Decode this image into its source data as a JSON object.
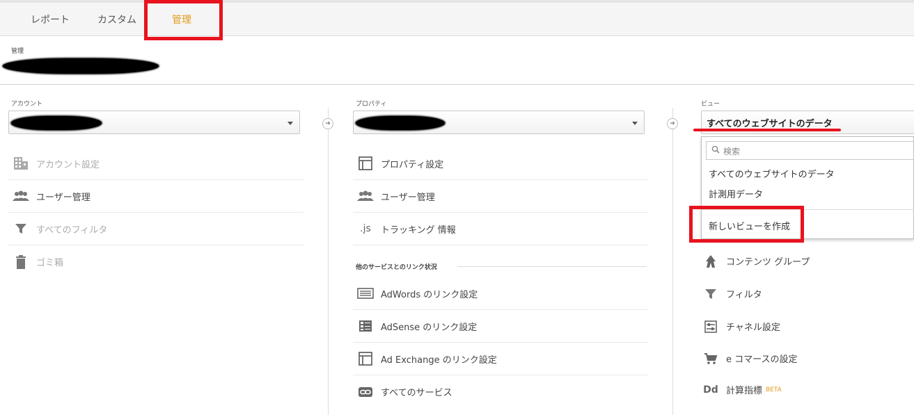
{
  "tabs": {
    "reports": "レポート",
    "custom": "カスタム",
    "admin": "管理"
  },
  "breadcrumb_label": "管理",
  "account": {
    "label": "アカウント",
    "items": [
      "アカウント設定",
      "ユーザー管理",
      "すべてのフィルタ",
      "ゴミ箱"
    ]
  },
  "property": {
    "label": "プロパティ",
    "items": [
      "プロパティ設定",
      "ユーザー管理",
      "トラッキング 情報"
    ],
    "section_title": "他のサービスとのリンク状況",
    "link_items": [
      "AdWords のリンク設定",
      "AdSense のリンク設定",
      "Ad Exchange のリンク設定",
      "すべてのサービス"
    ]
  },
  "view": {
    "label": "ビュー",
    "selected": "すべてのウェブサイトのデータ",
    "search_placeholder": "検索",
    "options": [
      "すべてのウェブサイトのデータ",
      "計測用データ"
    ],
    "create_new": "新しいビューを作成",
    "items": [
      "コンテンツ グループ",
      "フィルタ",
      "チャネル設定",
      "e コマースの設定",
      "計算指標"
    ],
    "beta_badge": "BETA",
    "dd_icon_text": "Dd"
  },
  "icons": {
    "js_text": ".js"
  },
  "colors": {
    "accent": "#e39a1a",
    "highlight_red": "#e8131f"
  }
}
